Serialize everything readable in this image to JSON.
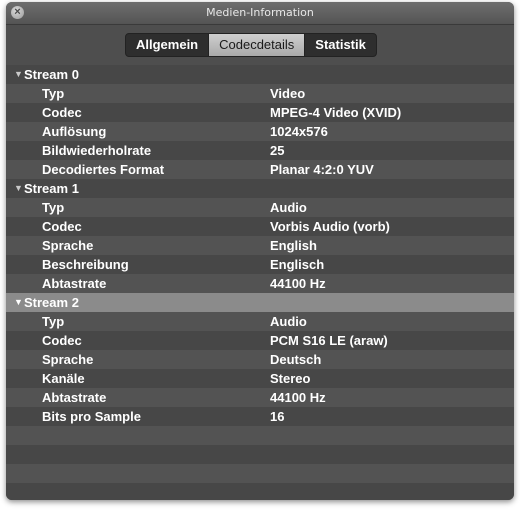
{
  "window": {
    "title": "Medien-Information",
    "close_icon": "close-icon"
  },
  "tabs": [
    {
      "label": "Allgemein",
      "active": false
    },
    {
      "label": "Codecdetails",
      "active": true
    },
    {
      "label": "Statistik",
      "active": false
    }
  ],
  "streams": [
    {
      "label": "Stream 0",
      "selected": false,
      "props": [
        {
          "key": "Typ",
          "value": "Video"
        },
        {
          "key": "Codec",
          "value": "MPEG-4 Video (XVID)"
        },
        {
          "key": "Auflösung",
          "value": "1024x576"
        },
        {
          "key": "Bildwiederholrate",
          "value": "25"
        },
        {
          "key": "Decodiertes Format",
          "value": "Planar 4:2:0 YUV"
        }
      ]
    },
    {
      "label": "Stream 1",
      "selected": false,
      "props": [
        {
          "key": "Typ",
          "value": "Audio"
        },
        {
          "key": "Codec",
          "value": "Vorbis Audio (vorb)"
        },
        {
          "key": "Sprache",
          "value": "English"
        },
        {
          "key": "Beschreibung",
          "value": "Englisch"
        },
        {
          "key": "Abtastrate",
          "value": "44100 Hz"
        }
      ]
    },
    {
      "label": "Stream 2",
      "selected": true,
      "props": [
        {
          "key": "Typ",
          "value": "Audio"
        },
        {
          "key": "Codec",
          "value": "PCM S16 LE (araw)"
        },
        {
          "key": "Sprache",
          "value": "Deutsch"
        },
        {
          "key": "Kanäle",
          "value": "Stereo"
        },
        {
          "key": "Abtastrate",
          "value": "44100 Hz"
        },
        {
          "key": "Bits pro Sample",
          "value": "16"
        }
      ]
    }
  ],
  "disclosure_icon": "disclosure-triangle-down-icon"
}
